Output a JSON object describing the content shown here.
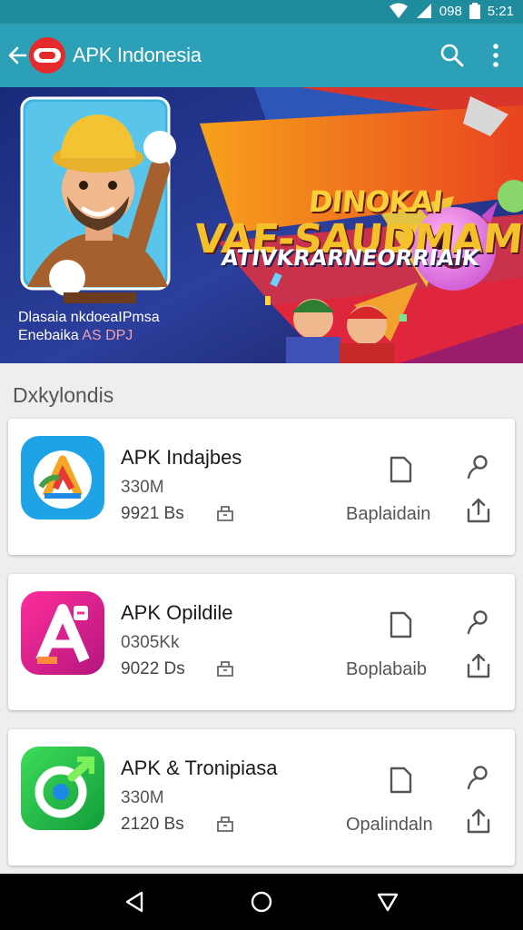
{
  "status": {
    "indicator": "098",
    "time": "5:21"
  },
  "header": {
    "title": "APK Indonesia"
  },
  "banner": {
    "headline_top": "DINOKAI",
    "headline_mid": "VAE-SAUDMAM",
    "headline_sub": "ATIVKRARNEORRIAIK",
    "caption_line1": "Dlasaia nkdoeaIPmsa",
    "caption_line2": "Enebaika",
    "caption_accent": "AS DPJ"
  },
  "section": {
    "title": "Dxkylondis"
  },
  "apps": [
    {
      "name": "APK Indajbes",
      "size": "330M",
      "count": "9921 Bs",
      "action": "Baplaidain"
    },
    {
      "name": "APK Opildile",
      "size": "0305Kk",
      "count": "9022 Ds",
      "action": "Boplabaib"
    },
    {
      "name": "APK & Tronipiasa",
      "size": "330M",
      "count": "2120 Bs",
      "action": "Opalindaln"
    }
  ],
  "icons": {
    "back": "arrow-left-icon",
    "search": "search-icon",
    "menu": "more-vert-icon",
    "download": "document-icon",
    "profile": "user-icon",
    "share": "share-icon",
    "nav_back": "triangle-back-icon",
    "nav_home": "circle-home-icon",
    "nav_recent": "triangle-down-icon"
  },
  "colors": {
    "status_bar": "#1f8c9d",
    "app_bar": "#2ba0b6",
    "logo": "#e42a2a"
  }
}
